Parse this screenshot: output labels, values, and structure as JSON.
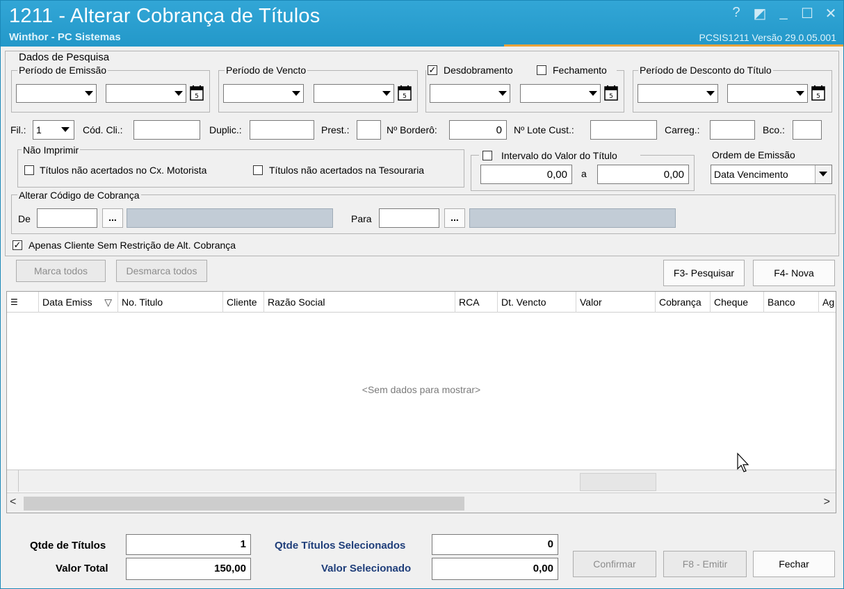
{
  "window": {
    "title": "1211 - Alterar Cobrança de Títulos",
    "subtitle": "Winthor - PC Sistemas",
    "version": "PCSIS1211  Versão  29.0.05.001",
    "controls": [
      "?",
      "◩",
      "_",
      "☐",
      "✕"
    ]
  },
  "search": {
    "legend": "Dados de Pesquisa",
    "emissao": "Período de Emissão",
    "vencto": "Período de Vencto",
    "desdobramento": "Desdobramento",
    "fechamento": "Fechamento",
    "desconto": "Período de Desconto do Título",
    "check_mark": "✓",
    "fil_label": "Fil.:",
    "fil_value": "1",
    "codcli_label": "Cód. Cli.:",
    "duplic_label": "Duplic.:",
    "prest_label": "Prest.:",
    "bordero_label": "Nº Borderô:",
    "bordero_value": "0",
    "lote_label": "Nº Lote Cust.:",
    "carreg_label": "Carreg.:",
    "bco_label": "Bco.:",
    "nao_imprimir": "Não Imprimir",
    "chk_motorista": "Títulos não acertados no Cx. Motorista",
    "chk_tesouraria": "Títulos não acertados na Tesouraria",
    "intervalo": "Intervalo do Valor do Título",
    "intervalo_de": "0,00",
    "intervalo_a_label": "a",
    "intervalo_ate": "0,00",
    "ordem_label": "Ordem de Emissão",
    "ordem_value": "Data Vencimento",
    "alterar_legend": "Alterar Código de Cobrança",
    "de_label": "De",
    "para_label": "Para",
    "ellipsis": "...",
    "apenas_cliente": "Apenas Cliente Sem Restrição de Alt. Cobrança"
  },
  "actions": {
    "marca_todos": "Marca todos",
    "desmarca_todos": "Desmarca todos",
    "pesquisar": "F3- Pesquisar",
    "nova": "F4- Nova"
  },
  "grid": {
    "columns": [
      "Data Emiss",
      "No. Titulo",
      "Cliente",
      "Razão Social",
      "RCA",
      "Dt. Vencto",
      "Valor",
      "Cobrança",
      "Cheque",
      "Banco",
      "Ag"
    ],
    "sort_indicator": "▽",
    "empty": "<Sem dados para mostrar>",
    "scroll_left": "<",
    "scroll_right": ">"
  },
  "footer": {
    "qtde_label": "Qtde de Títulos",
    "qtde_value": "1",
    "valor_label": "Valor Total",
    "valor_value": "150,00",
    "qtde_sel_label": "Qtde Títulos Selecionados",
    "qtde_sel_value": "0",
    "valor_sel_label": "Valor Selecionado",
    "valor_sel_value": "0,00",
    "confirmar": "Confirmar",
    "emitir": "F8 - Emitir",
    "fechar": "Fechar"
  }
}
